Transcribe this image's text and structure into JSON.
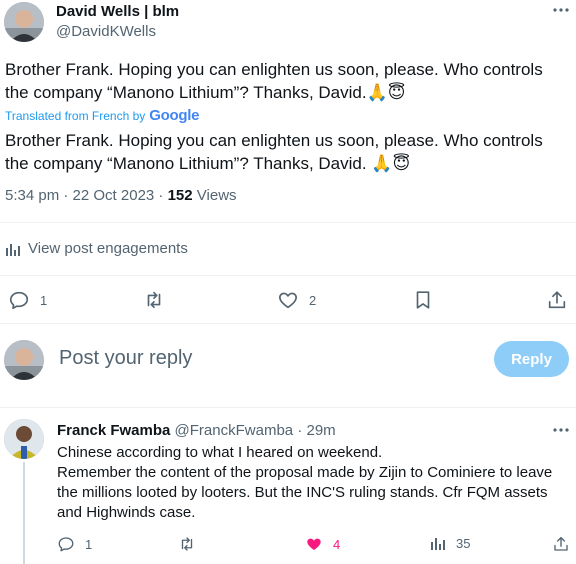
{
  "post": {
    "author_name": "David Wells | blm",
    "author_handle": "@DavidKWells",
    "text_original": "Brother Frank. Hoping you can enlighten us soon, please. Who controls the company “Manono Lithium”? Thanks, David.🙏😇",
    "translated_label": "Translated from French by",
    "translated_brand": "Google",
    "text_translated": "Brother Frank. Hoping you can enlighten us soon, please. Who controls the company “Manono Lithium”? Thanks, David. 🙏😇",
    "time": "5:34 pm · 22 Oct 2023 · ",
    "views_count": "152",
    "views_label": " Views",
    "engagements_label": "View post engagements",
    "replies": "1",
    "likes": "2"
  },
  "composer": {
    "placeholder": "Post your reply",
    "reply_button": "Reply"
  },
  "reply": {
    "author_name": "Franck Fwamba",
    "author_handle": "@FranckFwamba",
    "time": "· 29m",
    "text_line1": "Chinese according to what I heared on weekend.",
    "text_line2": "Remember the content of the proposal made by Zijin to Cominiere to leave the millions looted by looters. But the INC'S ruling stands. Cfr FQM assets and Highwinds case.",
    "replies": "1",
    "likes": "4",
    "views": "35"
  },
  "colors": {
    "accent": "#1d9bf0",
    "reply_button_disabled": "#8ecdf8",
    "like_active": "#f91880",
    "muted": "#536471"
  },
  "icons": [
    "more-icon",
    "reply-icon",
    "retweet-icon",
    "heart-icon",
    "bookmark-icon",
    "share-icon",
    "analytics-icon"
  ]
}
